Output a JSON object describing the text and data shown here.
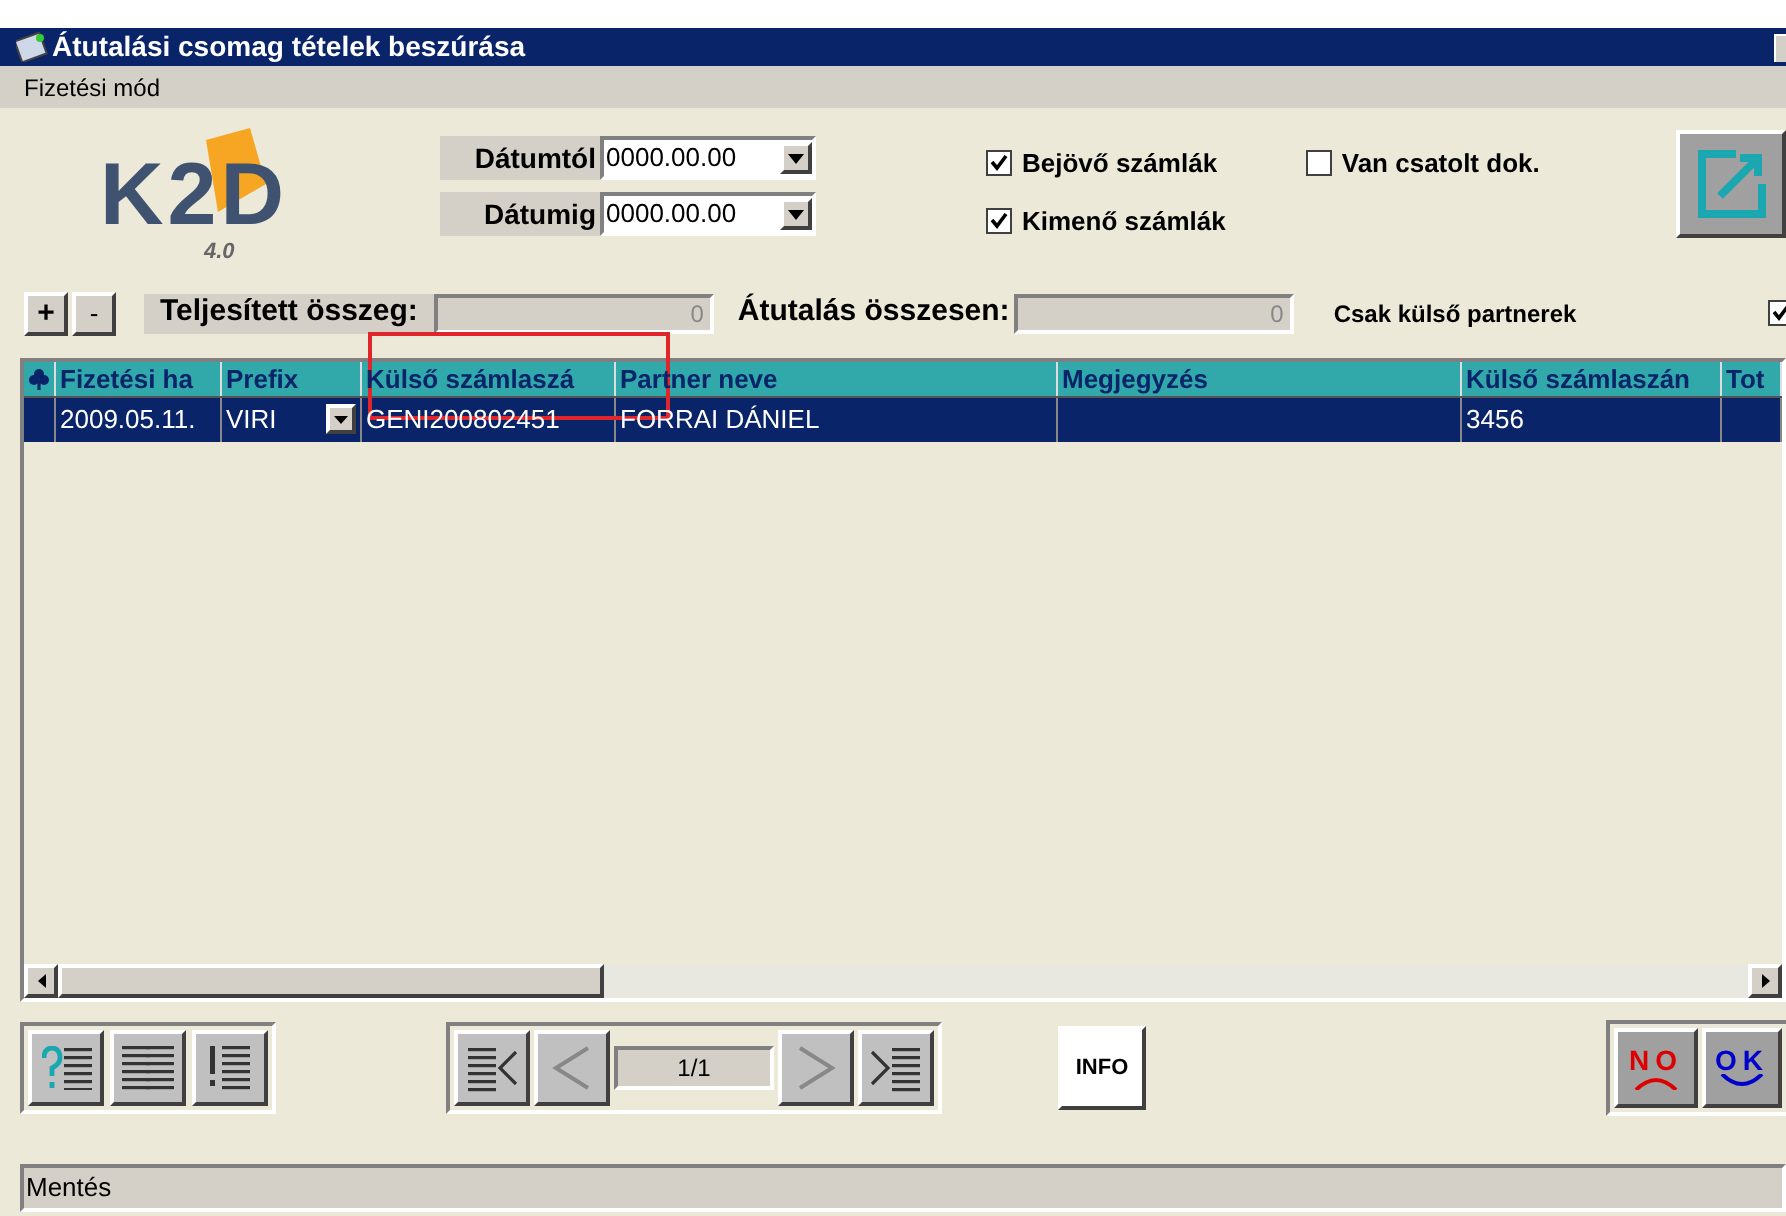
{
  "window": {
    "title": "Átutalási csomag tételek beszúrása"
  },
  "menu": [
    "Fizetési mód"
  ],
  "logo": {
    "text": "K2D",
    "version": "4.0"
  },
  "dates": [
    {
      "label": "Dátumtól",
      "value": "0000.00.00"
    },
    {
      "label": "Dátumig",
      "value": "0000.00.00"
    }
  ],
  "filters": [
    {
      "label": "Bejövő számlák",
      "checked": true
    },
    {
      "label": "Kimenő számlák",
      "checked": true
    },
    {
      "label": "Van csatolt dok.",
      "checked": false
    }
  ],
  "toolbar": {
    "add": "+",
    "remove": "-",
    "paid_label": "Teljesített összeg:",
    "paid_value": "0",
    "total_label": "Átutalás összesen:",
    "total_value": "0",
    "external_label": "Csak külső partnerek",
    "external_checked": true
  },
  "table": {
    "columns": [
      "Fizetési ha",
      "Prefix",
      "Külső számlaszá",
      "Partner neve",
      "Megjegyzés",
      "Külső számlaszán",
      "Tot"
    ],
    "rows": [
      {
        "selected": true,
        "cells": [
          "2009.05.11.",
          "VIRI",
          "GENI200802451",
          "FORRAI DÁNIEL",
          "",
          "3456",
          ""
        ]
      }
    ]
  },
  "pager": {
    "text": "1/1"
  },
  "buttons": {
    "info": "INFO",
    "no": "NO",
    "ok": "OK"
  },
  "status_bar": "Mentés"
}
